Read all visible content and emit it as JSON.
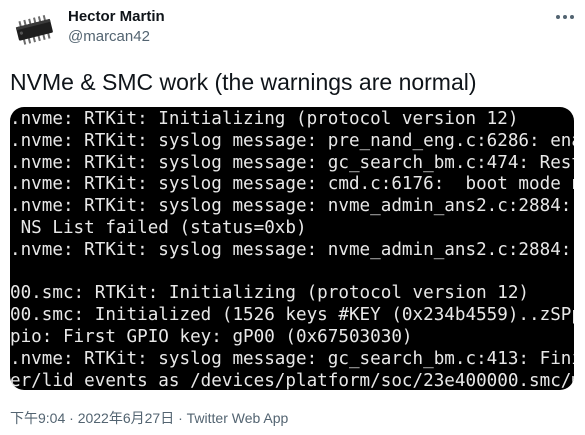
{
  "author": {
    "name": "Hector Martin",
    "handle": "@marcan42",
    "avatar_icon": "microchip-icon"
  },
  "more_icon": "more-options-icon",
  "tweet": {
    "text": "NVMe & SMC work (the warnings are normal)"
  },
  "terminal": {
    "lines": [
      ".nvme: RTKit: Initializing (protocol version 12)",
      ".nvme: RTKit: syslog message: pre_nand_eng.c:6286: ena",
      ".nvme: RTKit: syslog message: gc_search_bm.c:474: Rest",
      ".nvme: RTKit: syslog message: cmd.c:6176:  boot mode n",
      ".nvme: RTKit: syslog message: nvme_admin_ans2.c:2884:",
      " NS List failed (status=0xb)",
      ".nvme: RTKit: syslog message: nvme_admin_ans2.c:2884:",
      "",
      "00.smc: RTKit: Initializing (protocol version 12)",
      "00.smc: Initialized (1526 keys #KEY (0x234b4559)..zSPp",
      "pio: First GPIO key: gP00 (0x67503030)",
      ".nvme: RTKit: syslog message: gc_search_bm.c:413: Fini",
      "er/lid events as /devices/platform/soc/23e400000.smc/m"
    ],
    "colors": {
      "background": "#000000",
      "text": "#e8e8e8"
    }
  },
  "meta": {
    "timestamp": "下午9:04 · 2022年6月27日 · Twitter Web App"
  }
}
